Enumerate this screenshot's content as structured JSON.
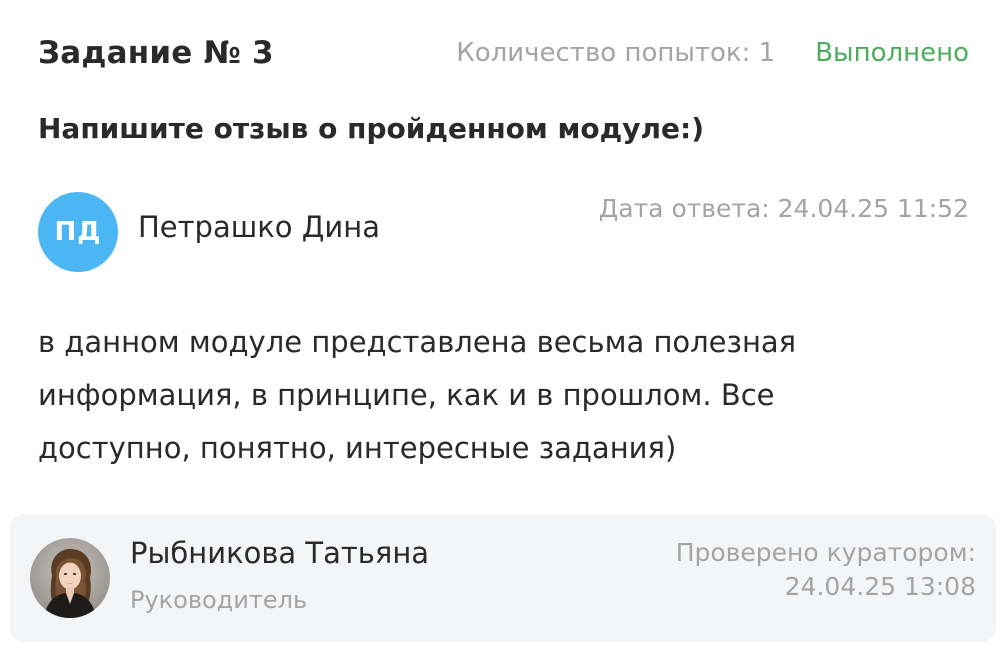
{
  "task": {
    "title": "Задание № 3",
    "attempts": "Количество попыток: 1",
    "status": "Выполнено",
    "status_color": "#4cae5c",
    "question": "Напишите отзыв о пройденном модуле:)"
  },
  "answer": {
    "author_initials": "ПД",
    "author_name": "Петрашко Дина",
    "avatar_color": "#4ab7f4",
    "date": "Дата ответа: 24.04.25 11:52",
    "text_lines": [
      "в данном модуле представлена весьма полезная",
      "информация, в принципе, как и в прошлом. Все",
      "доступно, понятно, интересные задания)"
    ]
  },
  "curator": {
    "name": "Рыбникова Татьяна",
    "role": "Руководитель",
    "avatar_icon": "user-photo",
    "checked_label": "Проверено куратором:",
    "checked_date": "24.04.25 13:08"
  }
}
